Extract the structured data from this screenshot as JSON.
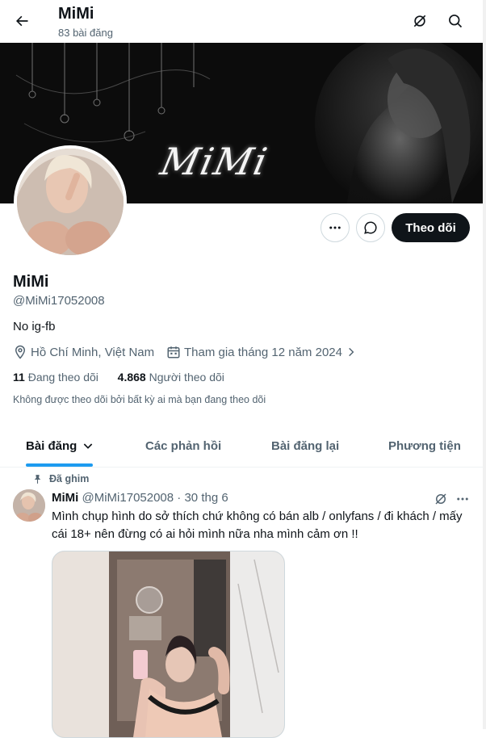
{
  "header": {
    "title": "MiMi",
    "post_count": "83 bài đăng",
    "back_icon": "arrow-left-icon",
    "grok_icon": "grok-icon",
    "search_icon": "search-icon"
  },
  "banner": {
    "text": "MiMi"
  },
  "actions": {
    "follow_label": "Theo dõi",
    "more_icon": "more-icon",
    "message_icon": "message-icon"
  },
  "profile": {
    "name": "MiMi",
    "handle": "@MiMi17052008",
    "bio": "No ig-fb",
    "location": "Hồ Chí Minh, Việt Nam",
    "joined": "Tham gia tháng 12 năm 2024",
    "following_count": "11",
    "following_label": "Đang theo dõi",
    "followers_count": "4.868",
    "followers_label": "Người theo dõi",
    "followed_by_notice": "Không được theo dõi bởi bất kỳ ai mà bạn đang theo dõi"
  },
  "tabs": [
    {
      "label": "Bài đăng",
      "active": true
    },
    {
      "label": "Các phản hồi",
      "active": false
    },
    {
      "label": "Bài đăng lại",
      "active": false
    },
    {
      "label": "Phương tiện",
      "active": false
    }
  ],
  "pinned_tweet": {
    "pinned_label": "Đã ghim",
    "name": "MiMi",
    "handle": "@MiMi17052008",
    "separator": "·",
    "date": "30 thg 6",
    "text": "Mình chụp hình do sở thích chứ không có bán alb / onlyfans / đi khách / mấy cái 18+ nên đừng có ai hỏi mình nữa nha mình cảm ơn !!"
  },
  "colors": {
    "accent": "#1d9bf0",
    "text_primary": "#0f1419",
    "text_secondary": "#536471",
    "button_dark": "#0f1419"
  }
}
